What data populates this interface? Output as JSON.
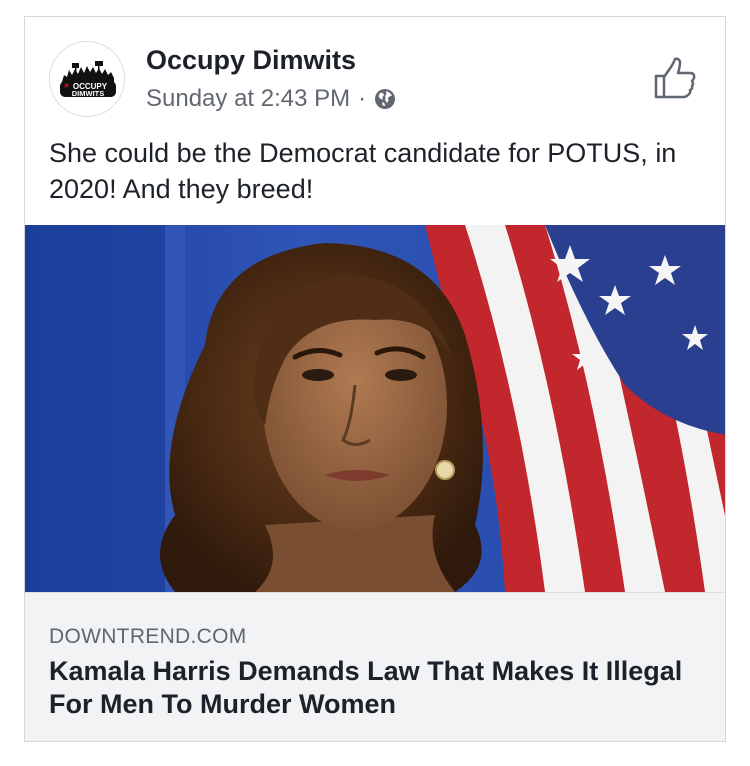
{
  "post": {
    "page_name": "Occupy Dimwits",
    "timestamp": "Sunday at 2:43 PM",
    "separator": "·",
    "audience_icon": "globe-icon",
    "text": "She could be the Democrat candidate for POTUS, in 2020!  And they breed!"
  },
  "avatar": {
    "logo_line1": "OCCUPY",
    "logo_line2": "DIMWITS"
  },
  "like": {
    "icon": "thumbs-up-icon"
  },
  "link_preview": {
    "domain": "DOWNTREND.COM",
    "headline": "Kamala Harris Demands Law That Makes It Illegal For Men To Murder Women"
  },
  "colors": {
    "text_primary": "#1d2129",
    "text_secondary": "#616770",
    "link_bg": "#f2f3f5",
    "card_border": "#d6d7da"
  }
}
